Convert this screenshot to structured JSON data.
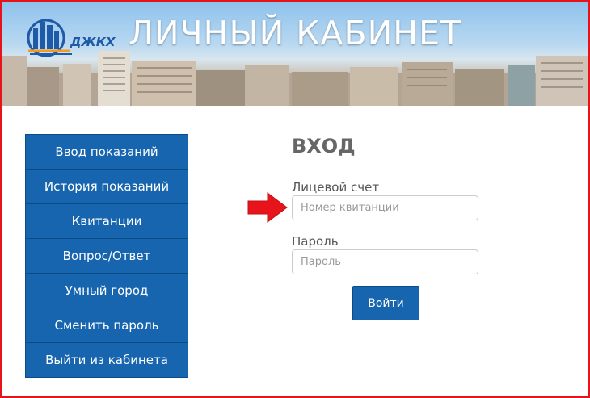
{
  "header": {
    "logo_text": "ДЖКХ",
    "title": "ЛИЧНЫЙ КАБИНЕТ"
  },
  "sidebar": {
    "items": [
      {
        "label": "Ввод показаний"
      },
      {
        "label": "История показаний"
      },
      {
        "label": "Квитанции"
      },
      {
        "label": "Вопрос/Ответ"
      },
      {
        "label": "Умный город"
      },
      {
        "label": "Сменить пароль"
      },
      {
        "label": "Выйти из кабинета"
      }
    ]
  },
  "login": {
    "heading": "ВХОД",
    "account_label": "Лицевой счет",
    "account_placeholder": "Номер квитанции",
    "password_label": "Пароль",
    "password_placeholder": "Пароль",
    "submit_label": "Войти"
  },
  "colors": {
    "frame": "#e5141b",
    "primary": "#1665ae",
    "arrow": "#e8141b"
  }
}
